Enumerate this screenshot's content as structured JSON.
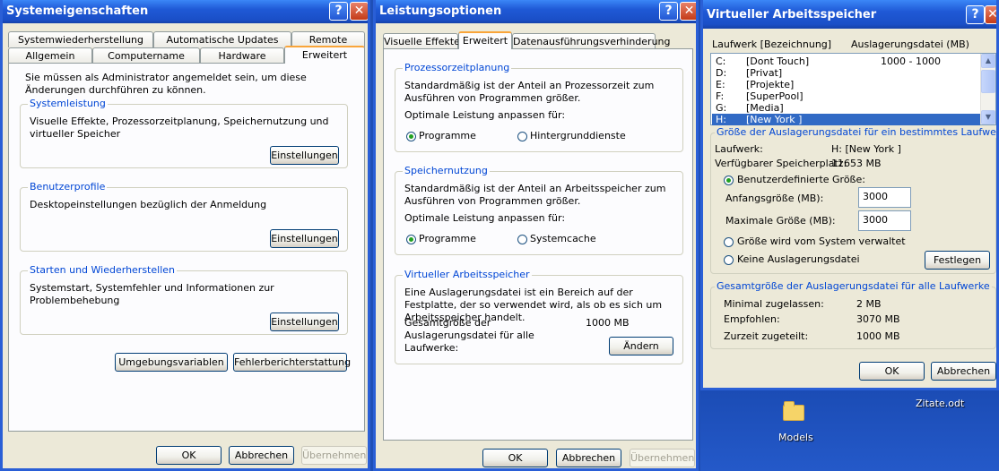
{
  "win1": {
    "title": "Systemeigenschaften",
    "help_glyph": "?",
    "close_glyph": "✕",
    "tabs_back": [
      "Systemwiederherstellung",
      "Automatische Updates",
      "Remote"
    ],
    "tabs_front": [
      "Allgemein",
      "Computername",
      "Hardware",
      "Erweitert"
    ],
    "intro": "Sie müssen als Administrator angemeldet sein, um diese Änderungen durchführen zu können.",
    "groups": [
      {
        "title": "Systemleistung",
        "text": "Visuelle Effekte, Prozessorzeitplanung, Speichernutzung und virtueller Speicher",
        "button": "Einstellungen"
      },
      {
        "title": "Benutzerprofile",
        "text": "Desktopeinstellungen bezüglich der Anmeldung",
        "button": "Einstellungen"
      },
      {
        "title": "Starten und Wiederherstellen",
        "text": "Systemstart, Systemfehler und Informationen zur Problembehebung",
        "button": "Einstellungen"
      }
    ],
    "env_button": "Umgebungsvariablen",
    "error_button": "Fehlerberichterstattung",
    "ok": "OK",
    "cancel": "Abbrechen",
    "apply": "Übernehmen"
  },
  "win2": {
    "title": "Leistungsoptionen",
    "help_glyph": "?",
    "close_glyph": "✕",
    "tabs": [
      "Visuelle Effekte",
      "Erweitert",
      "Datenausführungsverhinderung"
    ],
    "cpu": {
      "title": "Prozessorzeitplanung",
      "text": "Standardmäßig ist der Anteil an Prozessorzeit zum Ausführen von Programmen größer.",
      "label": "Optimale Leistung anpassen für:",
      "option1": "Programme",
      "option2": "Hintergrunddienste"
    },
    "mem": {
      "title": "Speichernutzung",
      "text": "Standardmäßig ist der Anteil an Arbeitsspeicher zum Ausführen von Programmen größer.",
      "label": "Optimale Leistung anpassen für:",
      "option1": "Programme",
      "option2": "Systemcache"
    },
    "vm": {
      "title": "Virtueller Arbeitsspeicher",
      "text": "Eine Auslagerungsdatei ist ein Bereich auf der Festplatte, der so verwendet wird, als ob es sich um Arbeitsspeicher handelt.",
      "total_label": "Gesamtgröße der Auslagerungsdatei für alle Laufwerke:",
      "total_value": "1000 MB",
      "button": "Ändern"
    },
    "ok": "OK",
    "cancel": "Abbrechen",
    "apply": "Übernehmen"
  },
  "win3": {
    "title": "Virtueller Arbeitsspeicher",
    "help_glyph": "?",
    "close_glyph": "✕",
    "col_drive": "Laufwerk [Bezeichnung]",
    "col_pagefile": "Auslagerungsdatei (MB)",
    "drives": [
      {
        "letter": "C:",
        "label": "[Dont Touch]",
        "size": "1000 - 1000"
      },
      {
        "letter": "D:",
        "label": "[Privat]",
        "size": ""
      },
      {
        "letter": "E:",
        "label": "[Projekte]",
        "size": ""
      },
      {
        "letter": "F:",
        "label": "[SuperPool]",
        "size": ""
      },
      {
        "letter": "G:",
        "label": "[Media]",
        "size": ""
      },
      {
        "letter": "H:",
        "label": "[New York ]",
        "size": ""
      }
    ],
    "scroll_up": "▲",
    "scroll_down": "▼",
    "drive_group": {
      "title": "Größe der Auslagerungsdatei für ein bestimmtes Laufwerk",
      "drive_label": "Laufwerk:",
      "drive_value": "H:  [New York ]",
      "free_label": "Verfügbarer Speicherplatz:",
      "free_value": "11653 MB",
      "custom": "Benutzerdefinierte Größe:",
      "initial_label": "Anfangsgröße (MB):",
      "initial_value": "3000",
      "max_label": "Maximale Größe (MB):",
      "max_value": "3000",
      "system_managed": "Größe wird vom System verwaltet",
      "no_pagefile": "Keine Auslagerungsdatei",
      "set_button": "Festlegen"
    },
    "total_group": {
      "title": "Gesamtgröße der Auslagerungsdatei für alle Laufwerke",
      "min_label": "Minimal zugelassen:",
      "min_value": "2 MB",
      "rec_label": "Empfohlen:",
      "rec_value": "3070 MB",
      "cur_label": "Zurzeit zugeteilt:",
      "cur_value": "1000 MB"
    },
    "ok": "OK",
    "cancel": "Abbrechen"
  },
  "desktop": {
    "folder_label": "Models",
    "file_label": "Zitate.odt"
  }
}
